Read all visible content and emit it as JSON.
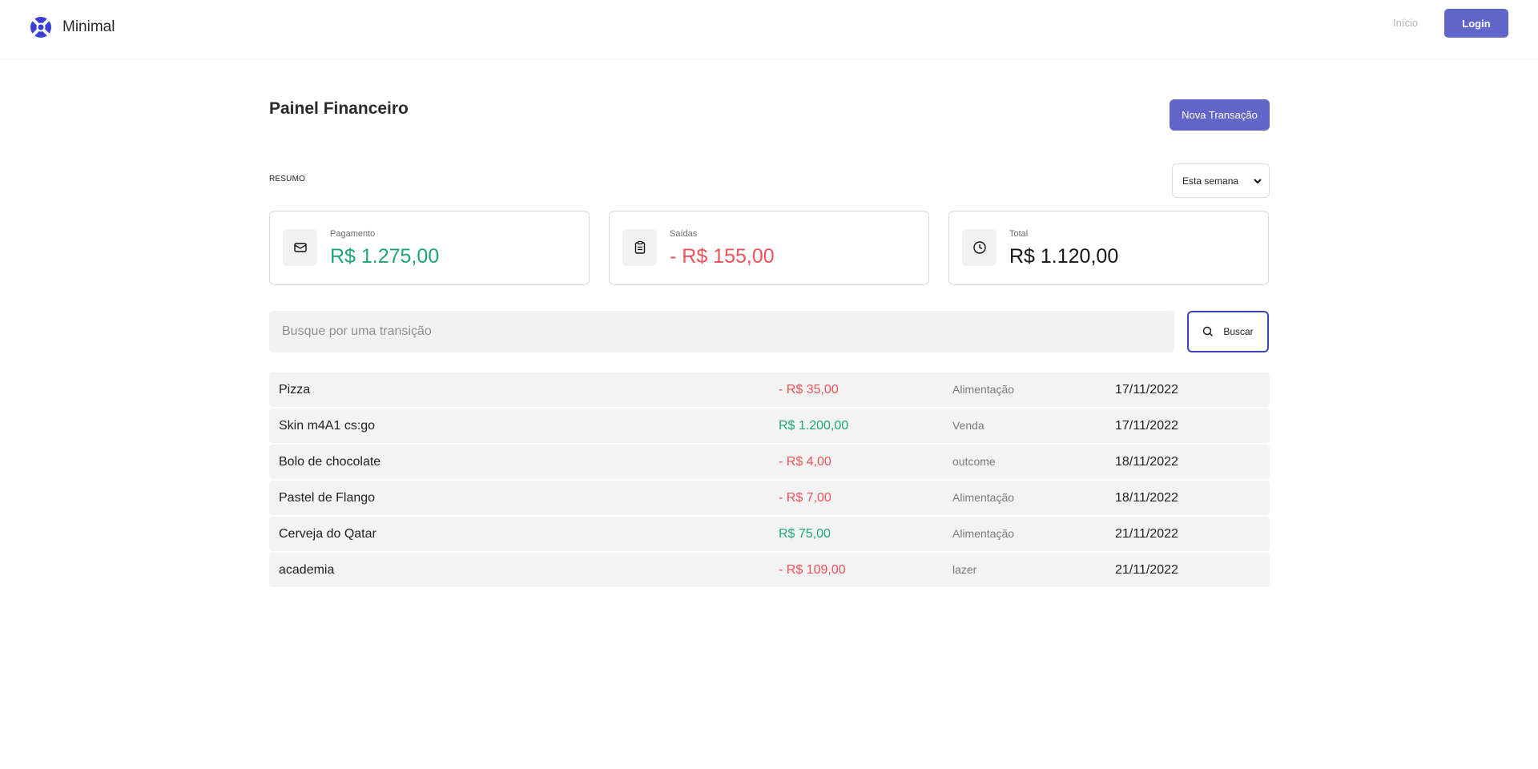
{
  "header": {
    "brand": "Minimal",
    "nav_link": "Início",
    "login_label": "Login"
  },
  "main": {
    "title": "Painel Financeiro",
    "new_transaction_label": "Nova Transação",
    "summary_label": "RESUMO",
    "period_selected": "Esta semana"
  },
  "cards": [
    {
      "label": "Pagamento",
      "value": "R$ 1.275,00",
      "icon": "wallet-icon",
      "tone": "green"
    },
    {
      "label": "Saídas",
      "value": "- R$ 155,00",
      "icon": "clipboard-icon",
      "tone": "red"
    },
    {
      "label": "Total",
      "value": "R$ 1.120,00",
      "icon": "clock-icon",
      "tone": "dark"
    }
  ],
  "search": {
    "placeholder": "Busque por uma transição",
    "button_label": "Buscar"
  },
  "transactions": [
    {
      "description": "Pizza",
      "amount": "- R$ 35,00",
      "type": "outcome",
      "category": "Alimentação",
      "date": "17/11/2022"
    },
    {
      "description": "Skin m4A1 cs:go",
      "amount": "R$ 1.200,00",
      "type": "income",
      "category": "Venda",
      "date": "17/11/2022"
    },
    {
      "description": "Bolo de chocolate",
      "amount": "- R$ 4,00",
      "type": "outcome",
      "category": "outcome",
      "date": "18/11/2022"
    },
    {
      "description": "Pastel de Flango",
      "amount": "- R$ 7,00",
      "type": "outcome",
      "category": "Alimentação",
      "date": "18/11/2022"
    },
    {
      "description": "Cerveja do Qatar",
      "amount": "R$ 75,00",
      "type": "income",
      "category": "Alimentação",
      "date": "21/11/2022"
    },
    {
      "description": "academia",
      "amount": "- R$ 109,00",
      "type": "outcome",
      "category": "lazer",
      "date": "21/11/2022"
    }
  ],
  "colors": {
    "accent": "#6166c8",
    "income": "#1ea774",
    "outcome": "#f0525a",
    "search_border": "#3d44b3"
  }
}
